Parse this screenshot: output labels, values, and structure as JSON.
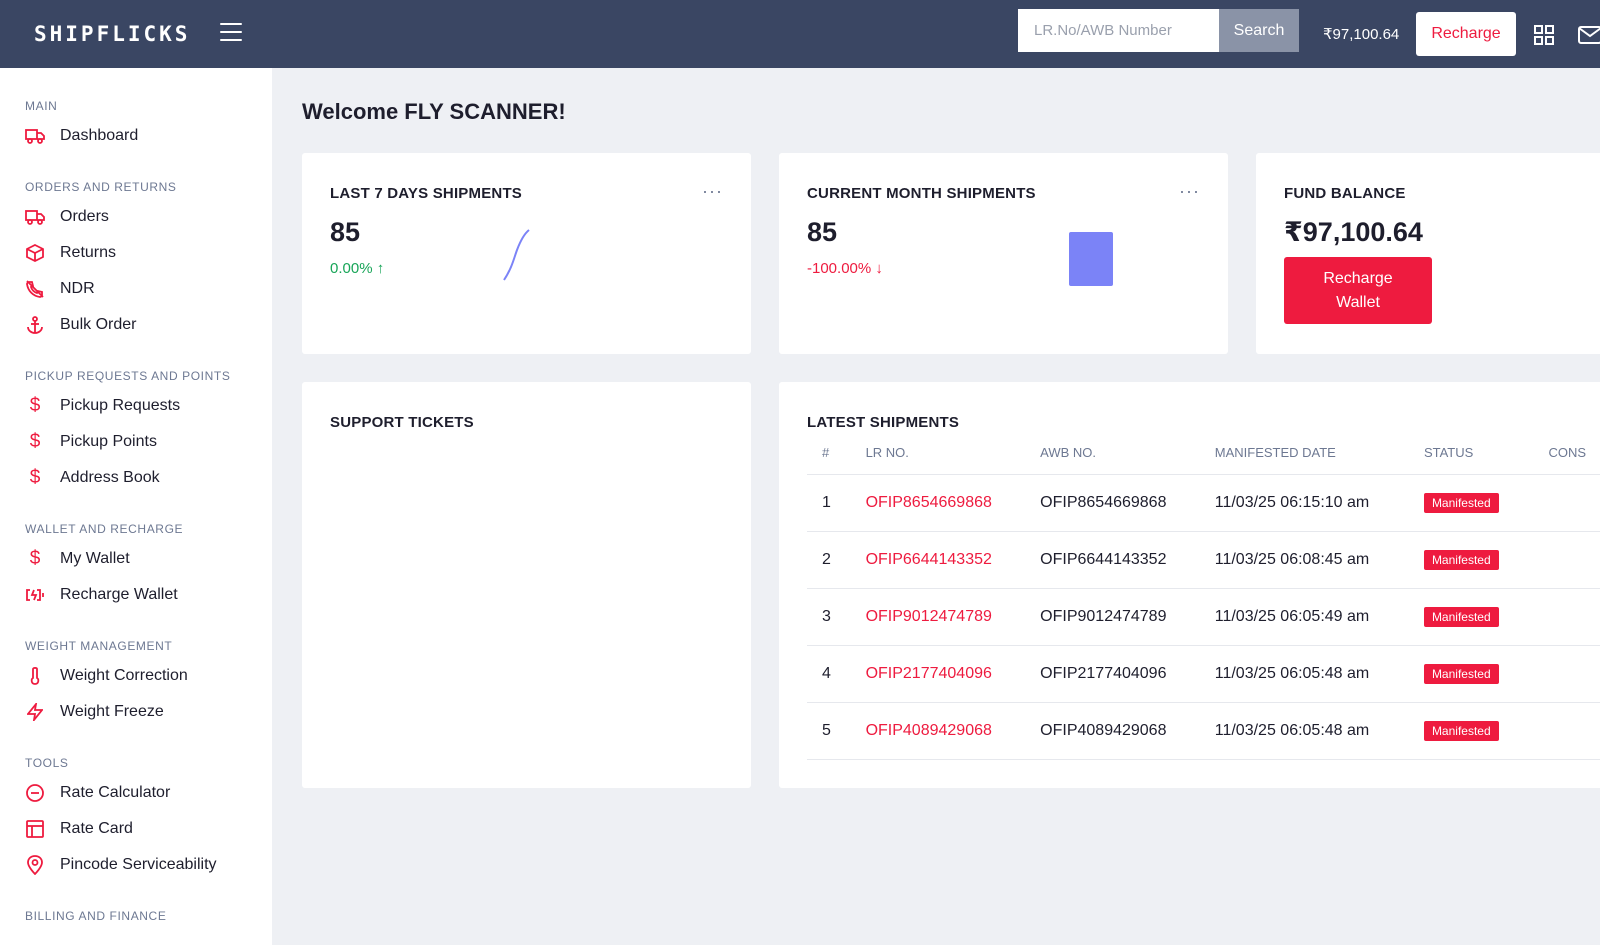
{
  "header": {
    "logo": "SHIPFLICKS",
    "search_placeholder": "LR.No/AWB Number",
    "search_label": "Search",
    "balance": "₹97,100.64",
    "recharge_label": "Recharge"
  },
  "sidebar": {
    "sections": [
      {
        "title": "MAIN",
        "items": [
          {
            "label": "Dashboard",
            "icon": "truck-icon"
          }
        ]
      },
      {
        "title": "ORDERS AND RETURNS",
        "items": [
          {
            "label": "Orders",
            "icon": "truck-icon"
          },
          {
            "label": "Returns",
            "icon": "box-icon"
          },
          {
            "label": "NDR",
            "icon": "phone-off-icon"
          },
          {
            "label": "Bulk Order",
            "icon": "anchor-icon"
          }
        ]
      },
      {
        "title": "PICKUP REQUESTS AND POINTS",
        "items": [
          {
            "label": "Pickup Requests",
            "icon": "dollar-icon"
          },
          {
            "label": "Pickup Points",
            "icon": "dollar-icon"
          },
          {
            "label": "Address Book",
            "icon": "dollar-icon"
          }
        ]
      },
      {
        "title": "WALLET AND RECHARGE",
        "items": [
          {
            "label": "My Wallet",
            "icon": "dollar-icon"
          },
          {
            "label": "Recharge Wallet",
            "icon": "battery-charging-icon"
          }
        ]
      },
      {
        "title": "WEIGHT MANAGEMENT",
        "items": [
          {
            "label": "Weight Correction",
            "icon": "thermometer-icon"
          },
          {
            "label": "Weight Freeze",
            "icon": "zap-icon"
          }
        ]
      },
      {
        "title": "TOOLS",
        "items": [
          {
            "label": "Rate Calculator",
            "icon": "minus-circle-icon"
          },
          {
            "label": "Rate Card",
            "icon": "table-icon"
          },
          {
            "label": "Pincode Serviceability",
            "icon": "map-pin-icon"
          }
        ]
      },
      {
        "title": "BILLING AND FINANCE",
        "items": []
      }
    ]
  },
  "main": {
    "welcome": "Welcome FLY SCANNER!",
    "last7": {
      "title": "LAST 7 DAYS SHIPMENTS",
      "value": "85",
      "change": "0.00% ↑"
    },
    "current_month": {
      "title": "CURRENT MONTH SHIPMENTS",
      "value": "85",
      "change": "-100.00% ↓"
    },
    "fund": {
      "title": "FUND BALANCE",
      "value": "₹97,100.64",
      "button": "Recharge Wallet"
    },
    "support": {
      "title": "SUPPORT TICKETS"
    },
    "latest": {
      "title": "LATEST SHIPMENTS",
      "columns": [
        "#",
        "LR NO.",
        "AWB NO.",
        "MANIFESTED DATE",
        "STATUS",
        "CONS"
      ],
      "rows": [
        {
          "n": "1",
          "lr": "OFIP8654669868",
          "awb": "OFIP8654669868",
          "date": "11/03/25 06:15:10 am",
          "status": "Manifested"
        },
        {
          "n": "2",
          "lr": "OFIP6644143352",
          "awb": "OFIP6644143352",
          "date": "11/03/25 06:08:45 am",
          "status": "Manifested"
        },
        {
          "n": "3",
          "lr": "OFIP9012474789",
          "awb": "OFIP9012474789",
          "date": "11/03/25 06:05:49 am",
          "status": "Manifested"
        },
        {
          "n": "4",
          "lr": "OFIP2177404096",
          "awb": "OFIP2177404096",
          "date": "11/03/25 06:05:48 am",
          "status": "Manifested"
        },
        {
          "n": "5",
          "lr": "OFIP4089429068",
          "awb": "OFIP4089429068",
          "date": "11/03/25 06:05:48 am",
          "status": "Manifested"
        }
      ]
    }
  },
  "colors": {
    "header_bg": "#3a4663",
    "accent": "#ee1b3f",
    "chart_bar": "#7b83f7",
    "positive": "#18a558"
  }
}
